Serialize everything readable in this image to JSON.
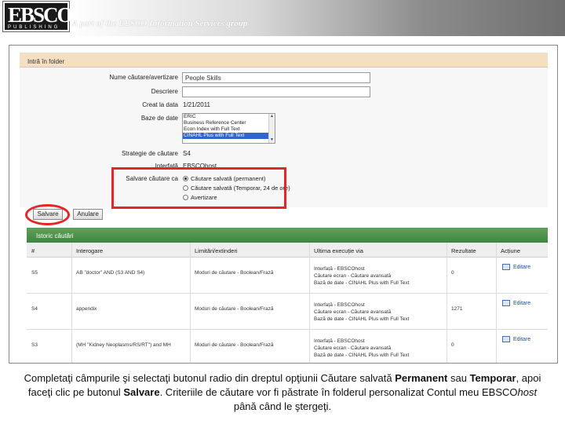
{
  "banner": {
    "logo_main": "EBSCO",
    "logo_sub": "PUBLISHING",
    "tagline": "A part of the EBSCO Information Services group"
  },
  "panel": {
    "header": "Intră în folder"
  },
  "form": {
    "name_label": "Nume căutare/avertizare",
    "name_value": "People Skills",
    "description_label": "Descriere",
    "description_value": "",
    "created_label": "Creat la data",
    "created_value": "1/21/2011",
    "databases_label": "Baze de date",
    "databases_options": [
      "ERIC",
      "Business Reference Center",
      "Econ Index with Full Text",
      "CINAHL Plus with Full Text"
    ],
    "databases_selected_index": 3,
    "strategy_label": "Strategie de căutare",
    "strategy_value": "S4",
    "interface_label": "Interfață",
    "interface_value": "EBSCOhost",
    "save_as_label": "Salvare căutare ca",
    "radio_options": [
      "Căutare salvată (permanent)",
      "Căutare salvată (Temporar, 24 de ore)",
      "Avertizare"
    ],
    "radio_selected_index": 0,
    "save_button": "Salvare",
    "cancel_button": "Anulare"
  },
  "history": {
    "title": "Istoric căutări",
    "columns": [
      "#",
      "Interogare",
      "Limitări/extinderi",
      "Ultima execuție via",
      "Rezultate",
      "Acțiune"
    ],
    "rows": [
      {
        "num": "S5",
        "query": "AB \"doctor\" AND (S3 AND S4)",
        "limits": "Moduri de căutare - Boolean/Frază",
        "via_1": "Interfață - EBSCOhost",
        "via_2": "Căutare ecran - Căutare avansată",
        "via_3": "Bază de date - CINAHL Plus with Full Text",
        "results": "0",
        "action": "Editare"
      },
      {
        "num": "S4",
        "query": "appendix",
        "limits": "Moduri de căutare - Boolean/Frază",
        "via_1": "Interfață - EBSCOhost",
        "via_2": "Căutare ecran - Căutare avansată",
        "via_3": "Bază de date - CINAHL Plus with Full Text",
        "results": "1271",
        "action": "Editare"
      },
      {
        "num": "S3",
        "query": "(MH \"Kidney Neoplasms/RS/RT\") and MH",
        "limits": "Moduri de căutare - Boolean/Frază",
        "via_1": "Interfață - EBSCOhost",
        "via_2": "Căutare ecran - Căutare avansată",
        "via_3": "Bază de date - CINAHL Plus with Full Text",
        "results": "0",
        "action": "Editare"
      }
    ]
  },
  "caption": {
    "part1": "Completaţi câmpurile şi selectaţi butonul radio din dreptul opţiunii Căutare salvată ",
    "bold1": "Permanent",
    "part2": " sau ",
    "bold2": "Temporar",
    "part3": ", apoi faceţi clic pe butonul ",
    "bold3": "Salvare",
    "part4": ". Criteriile de căutare vor fi păstrate în folderul personalizat Contul meu EBSCO",
    "italic1": "host",
    "part5": " până când le ştergeţi."
  },
  "colors": {
    "highlight_red": "#e3262b",
    "history_green": "#4a914a",
    "panel_header": "#f4dfc2"
  }
}
